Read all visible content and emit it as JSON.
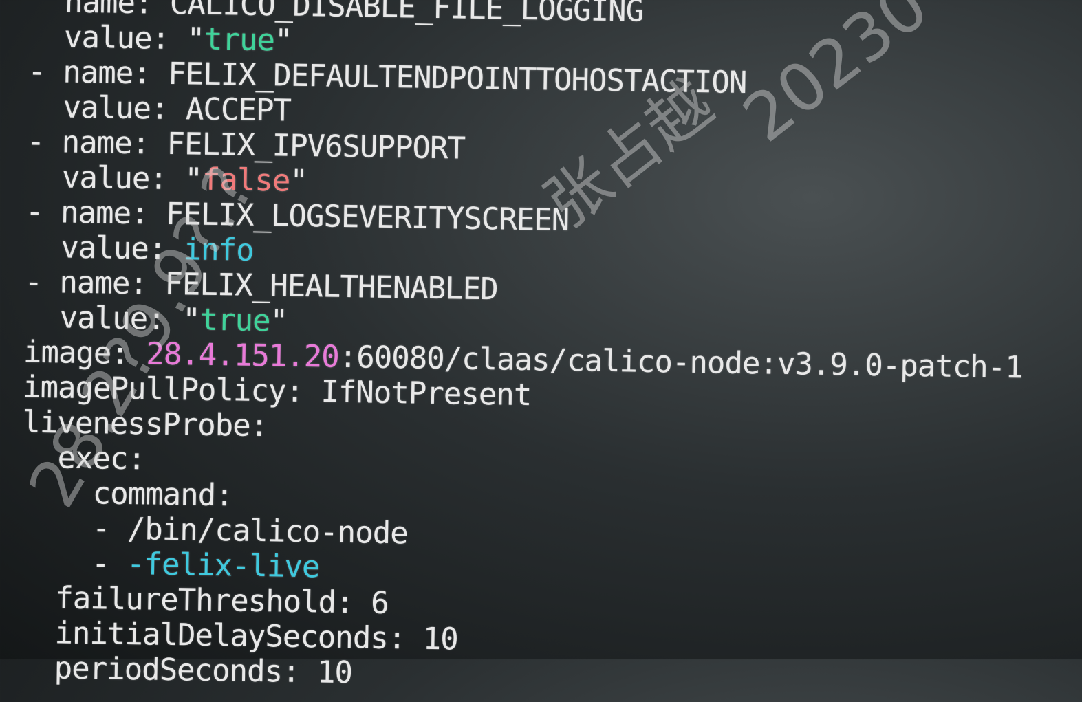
{
  "terminal": {
    "lines": [
      {
        "indent": 2,
        "segments": [
          {
            "text": "name: CALICO_DISABLE_FILE_LOGGING",
            "color": "white"
          }
        ]
      },
      {
        "indent": 2,
        "segments": [
          {
            "text": "value: ",
            "color": "white"
          },
          {
            "text": "\"",
            "color": "white"
          },
          {
            "text": "true",
            "color": "green"
          },
          {
            "text": "\"",
            "color": "white"
          }
        ]
      },
      {
        "indent": 0,
        "segments": [
          {
            "text": "- name: FELIX_DEFAULTENDPOINTTOHOSTACTION",
            "color": "white"
          }
        ]
      },
      {
        "indent": 2,
        "segments": [
          {
            "text": "value: ACCEPT",
            "color": "white"
          }
        ]
      },
      {
        "indent": 0,
        "segments": [
          {
            "text": "- name: FELIX_IPV6SUPPORT",
            "color": "white"
          }
        ]
      },
      {
        "indent": 2,
        "segments": [
          {
            "text": "value: ",
            "color": "white"
          },
          {
            "text": "\"",
            "color": "white"
          },
          {
            "text": "false",
            "color": "red"
          },
          {
            "text": "\"",
            "color": "white"
          }
        ]
      },
      {
        "indent": 0,
        "segments": [
          {
            "text": "- name: FELIX_LOGSEVERITYSCREEN",
            "color": "white"
          }
        ]
      },
      {
        "indent": 2,
        "segments": [
          {
            "text": "value: ",
            "color": "white"
          },
          {
            "text": "info",
            "color": "cyan"
          }
        ]
      },
      {
        "indent": 0,
        "segments": [
          {
            "text": "- name: FELIX_HEALTHENABLED",
            "color": "white"
          }
        ]
      },
      {
        "indent": 2,
        "segments": [
          {
            "text": "value: ",
            "color": "white"
          },
          {
            "text": "\"",
            "color": "white"
          },
          {
            "text": "true",
            "color": "green"
          },
          {
            "text": "\"",
            "color": "white"
          }
        ]
      },
      {
        "indent": 0,
        "segments": [
          {
            "text": "image: ",
            "color": "white"
          },
          {
            "text": "28.4.151.20",
            "color": "magenta"
          },
          {
            "text": ":60080/claas/calico-node:v3.9.0-patch-1",
            "color": "white"
          }
        ]
      },
      {
        "indent": 0,
        "segments": [
          {
            "text": "imagePullPolicy: IfNotPresent",
            "color": "white"
          }
        ]
      },
      {
        "indent": 0,
        "segments": [
          {
            "text": "livenessProbe:",
            "color": "white"
          }
        ]
      },
      {
        "indent": 2,
        "segments": [
          {
            "text": "exec:",
            "color": "white"
          }
        ]
      },
      {
        "indent": 4,
        "segments": [
          {
            "text": "command:",
            "color": "white"
          }
        ]
      },
      {
        "indent": 4,
        "segments": [
          {
            "text": "- /bin/calico-node",
            "color": "white"
          }
        ]
      },
      {
        "indent": 4,
        "segments": [
          {
            "text": "- ",
            "color": "white"
          },
          {
            "text": "-felix-live",
            "color": "cyan"
          }
        ]
      },
      {
        "indent": 2,
        "segments": [
          {
            "text": "failureThreshold: 6",
            "color": "white"
          }
        ]
      },
      {
        "indent": 2,
        "segments": [
          {
            "text": "initialDelaySeconds: 10",
            "color": "white"
          }
        ]
      },
      {
        "indent": 2,
        "segments": [
          {
            "text": "periodSeconds: 10",
            "color": "white"
          }
        ]
      }
    ]
  },
  "watermark": {
    "name": "张占越",
    "date": "20230",
    "ip": "28.2?9.9?.?"
  },
  "colors": {
    "white": "#e8e8e8",
    "green": "#3fd39a",
    "red": "#f07a7a",
    "cyan": "#3fc9de",
    "magenta": "#e87ad8"
  }
}
